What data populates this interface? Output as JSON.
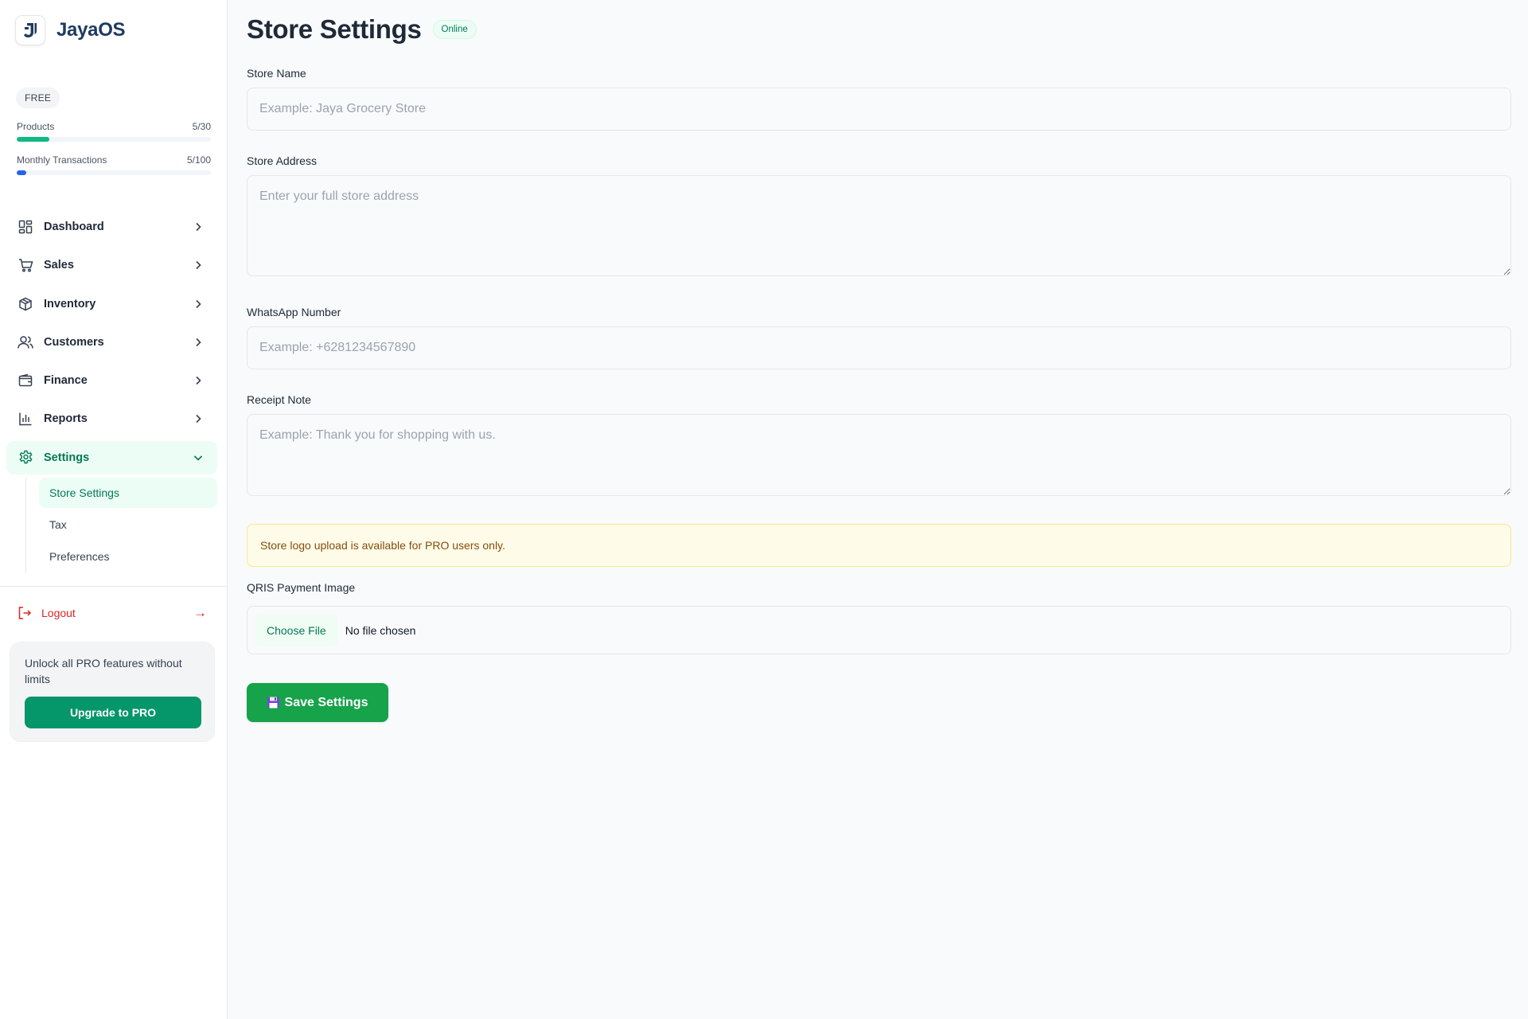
{
  "brand": {
    "name": "JayaOS"
  },
  "plan": {
    "badge": "FREE",
    "usage": [
      {
        "label": "Products",
        "value": "5/30",
        "fraction": 0.1667,
        "color": "#10b981"
      },
      {
        "label": "Monthly Transactions",
        "value": "5/100",
        "fraction": 0.05,
        "color": "#2563eb"
      }
    ]
  },
  "nav": {
    "items": [
      {
        "label": "Dashboard",
        "icon": "dashboard-icon"
      },
      {
        "label": "Sales",
        "icon": "cart-icon"
      },
      {
        "label": "Inventory",
        "icon": "box-icon"
      },
      {
        "label": "Customers",
        "icon": "users-icon"
      },
      {
        "label": "Finance",
        "icon": "wallet-icon"
      },
      {
        "label": "Reports",
        "icon": "bar-chart-icon"
      },
      {
        "label": "Settings",
        "icon": "gear-icon",
        "active": true,
        "expanded": true
      }
    ],
    "sub_items": [
      {
        "label": "Store Settings",
        "active": true
      },
      {
        "label": "Tax"
      },
      {
        "label": "Preferences"
      }
    ]
  },
  "logout": {
    "label": "Logout",
    "arrow": "→"
  },
  "promo": {
    "text": "Unlock all PRO features without limits",
    "button": "Upgrade to PRO"
  },
  "page": {
    "title": "Store Settings",
    "status": "Online"
  },
  "form": {
    "store_name": {
      "label": "Store Name",
      "placeholder": "Example: Jaya Grocery Store",
      "value": ""
    },
    "store_address": {
      "label": "Store Address",
      "placeholder": "Enter your full store address",
      "value": ""
    },
    "whatsapp": {
      "label": "WhatsApp Number",
      "placeholder": "Example: +6281234567890",
      "value": ""
    },
    "receipt_note": {
      "label": "Receipt Note",
      "placeholder": "Example: Thank you for shopping with us.",
      "value": ""
    },
    "logo_notice": "Store logo upload is available for PRO users only.",
    "qris": {
      "label": "QRIS Payment Image",
      "button": "Choose File",
      "status": "No file chosen"
    },
    "save_button": "Save Settings"
  },
  "colors": {
    "accent": "#059669",
    "accent_light": "#ecfdf5",
    "danger": "#dc2626",
    "warning_bg": "#fefce8",
    "save": "#16a34a"
  }
}
